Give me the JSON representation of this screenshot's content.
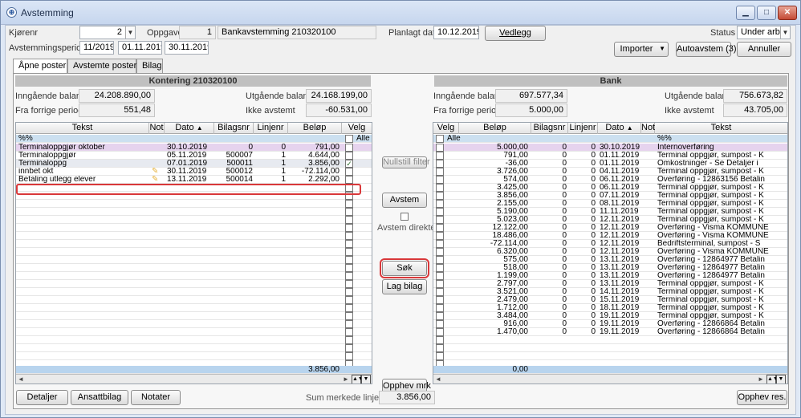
{
  "window": {
    "title": "Avstemming",
    "minimize": "▁",
    "maximize": "□",
    "close": "✕"
  },
  "header": {
    "kjorenr_label": "Kjørenr",
    "kjorenr_value": "2",
    "oppgave_label": "Oppgave",
    "oppgave_value": "1",
    "oppgave_text": "Bankavstemming 210320100",
    "planlagt_label": "Planlagt dato",
    "planlagt_value": "10.12.2019",
    "vedlegg_label": "Vedlegg",
    "status_label": "Status",
    "status_value": "Under arbeid",
    "periode_label": "Avstemmingsperiode",
    "periode_value": "11/2019",
    "fra_dato": "01.11.2019",
    "til_dato": "30.11.2019",
    "importer_label": "Importer",
    "autoavstem_label": "Autoavstem (3)",
    "annuller_label": "Annuller"
  },
  "tabs": [
    "Åpne poster",
    "Avstemte poster",
    "Bilag"
  ],
  "left": {
    "section_title": "Kontering 210320100",
    "inngaende_label": "Inngående balanse",
    "inngaende_value": "24.208.890,00",
    "utgaende_label": "Utgående balanse",
    "utgaende_value": "24.168.199,00",
    "forrige_label": "Fra forrige periode",
    "forrige_value": "551,48",
    "ikke_label": "Ikke avstemt",
    "ikke_value": "-60.531,00",
    "columns": [
      "Tekst",
      "Not",
      "Dato",
      "Bilagsnr",
      "Linjenr",
      "Beløp",
      "Velg"
    ],
    "filter": {
      "tekst": "%%",
      "velg": "Alle"
    },
    "rows": [
      {
        "tekst": "Terminaloppgjør oktober",
        "dato": "30.10.2019",
        "bilag": "0",
        "linje": "0",
        "belop": "791,00",
        "style": "purple",
        "note": false,
        "checked": false
      },
      {
        "tekst": "Terminaloppgjør",
        "dato": "05.11.2019",
        "bilag": "500007",
        "linje": "1",
        "belop": "4.644,00",
        "style": "",
        "note": false,
        "checked": false
      },
      {
        "tekst": "Terminaloppg",
        "dato": "07.01.2019",
        "bilag": "500011",
        "linje": "1",
        "belop": "3.856,00",
        "style": "sel",
        "note": false,
        "checked": true
      },
      {
        "tekst": "innbet okt",
        "dato": "30.11.2019",
        "bilag": "500012",
        "linje": "1",
        "belop": "-72.114,00",
        "style": "",
        "note": true,
        "checked": false
      },
      {
        "tekst": "Betaling utlegg elever",
        "dato": "13.11.2019",
        "bilag": "500014",
        "linje": "1",
        "belop": "2.292,00",
        "style": "",
        "note": true,
        "checked": false
      }
    ],
    "sum": "3.856,00"
  },
  "middle": {
    "nullstill_label": "Nullstill filter",
    "avstem_label": "Avstem",
    "avstem_direkte_label": "Avstem direkte",
    "sok_label": "Søk",
    "lag_bilag_label": "Lag bilag",
    "opphev_mrk_label": "Opphev mrk"
  },
  "right": {
    "section_title": "Bank",
    "inngaende_label": "Inngående balanse",
    "inngaende_value": "697.577,34",
    "utgaende_label": "Utgående balanse",
    "utgaende_value": "756.673,82",
    "forrige_label": "Fra forrige periode",
    "forrige_value": "5.000,00",
    "ikke_label": "Ikke avstemt",
    "ikke_value": "43.705,00",
    "columns": [
      "Velg",
      "Beløp",
      "Bilagsnr",
      "Linjenr",
      "Dato",
      "Not",
      "Tekst"
    ],
    "filter": {
      "velg": "Alle",
      "tekst": "%%"
    },
    "rows": [
      {
        "belop": "5.000,00",
        "bilag": "0",
        "linje": "0",
        "dato": "30.10.2019",
        "tekst": "Internoverføring",
        "style": "purple"
      },
      {
        "belop": "791,00",
        "bilag": "0",
        "linje": "0",
        "dato": "01.11.2019",
        "tekst": "Terminal oppgjør, sumpost - K",
        "style": ""
      },
      {
        "belop": "-36,00",
        "bilag": "0",
        "linje": "0",
        "dato": "01.11.2019",
        "tekst": "Omkostninger - Se Detaljer i",
        "style": ""
      },
      {
        "belop": "3.726,00",
        "bilag": "0",
        "linje": "0",
        "dato": "04.11.2019",
        "tekst": "Terminal oppgjør, sumpost - K",
        "style": ""
      },
      {
        "belop": "574,00",
        "bilag": "0",
        "linje": "0",
        "dato": "06.11.2019",
        "tekst": "Overføring - 12863156 Betalin",
        "style": ""
      },
      {
        "belop": "3.425,00",
        "bilag": "0",
        "linje": "0",
        "dato": "06.11.2019",
        "tekst": "Terminal oppgjør, sumpost - K",
        "style": ""
      },
      {
        "belop": "3.856,00",
        "bilag": "0",
        "linje": "0",
        "dato": "07.11.2019",
        "tekst": "Terminal oppgjør, sumpost - K",
        "style": ""
      },
      {
        "belop": "2.155,00",
        "bilag": "0",
        "linje": "0",
        "dato": "08.11.2019",
        "tekst": "Terminal oppgjør, sumpost - K",
        "style": ""
      },
      {
        "belop": "5.190,00",
        "bilag": "0",
        "linje": "0",
        "dato": "11.11.2019",
        "tekst": "Terminal oppgjør, sumpost - K",
        "style": ""
      },
      {
        "belop": "5.023,00",
        "bilag": "0",
        "linje": "0",
        "dato": "12.11.2019",
        "tekst": "Terminal oppgjør, sumpost - K",
        "style": ""
      },
      {
        "belop": "12.122,00",
        "bilag": "0",
        "linje": "0",
        "dato": "12.11.2019",
        "tekst": "Overføring - Visma KOMMUNE",
        "style": ""
      },
      {
        "belop": "18.486,00",
        "bilag": "0",
        "linje": "0",
        "dato": "12.11.2019",
        "tekst": "Overføring - Visma KOMMUNE",
        "style": ""
      },
      {
        "belop": "-72.114,00",
        "bilag": "0",
        "linje": "0",
        "dato": "12.11.2019",
        "tekst": "Bedriftsterminal, sumpost - S",
        "style": ""
      },
      {
        "belop": "6.320,00",
        "bilag": "0",
        "linje": "0",
        "dato": "12.11.2019",
        "tekst": "Overføring - Visma KOMMUNE",
        "style": ""
      },
      {
        "belop": "575,00",
        "bilag": "0",
        "linje": "0",
        "dato": "13.11.2019",
        "tekst": "Overføring - 12864977 Betalin",
        "style": ""
      },
      {
        "belop": "518,00",
        "bilag": "0",
        "linje": "0",
        "dato": "13.11.2019",
        "tekst": "Overføring - 12864977 Betalin",
        "style": ""
      },
      {
        "belop": "1.199,00",
        "bilag": "0",
        "linje": "0",
        "dato": "13.11.2019",
        "tekst": "Overføring - 12864977 Betalin",
        "style": ""
      },
      {
        "belop": "2.797,00",
        "bilag": "0",
        "linje": "0",
        "dato": "13.11.2019",
        "tekst": "Terminal oppgjør, sumpost - K",
        "style": ""
      },
      {
        "belop": "3.521,00",
        "bilag": "0",
        "linje": "0",
        "dato": "14.11.2019",
        "tekst": "Terminal oppgjør, sumpost - K",
        "style": ""
      },
      {
        "belop": "2.479,00",
        "bilag": "0",
        "linje": "0",
        "dato": "15.11.2019",
        "tekst": "Terminal oppgjør, sumpost - K",
        "style": ""
      },
      {
        "belop": "1.712,00",
        "bilag": "0",
        "linje": "0",
        "dato": "18.11.2019",
        "tekst": "Terminal oppgjør, sumpost - K",
        "style": ""
      },
      {
        "belop": "3.484,00",
        "bilag": "0",
        "linje": "0",
        "dato": "19.11.2019",
        "tekst": "Terminal oppgjør, sumpost - K",
        "style": ""
      },
      {
        "belop": "916,00",
        "bilag": "0",
        "linje": "0",
        "dato": "19.11.2019",
        "tekst": "Overføring - 12866864 Betalin",
        "style": ""
      },
      {
        "belop": "1.470,00",
        "bilag": "0",
        "linje": "0",
        "dato": "19.11.2019",
        "tekst": "Overføring - 12866864 Betalin",
        "style": ""
      }
    ],
    "sum": "0,00"
  },
  "footer": {
    "detaljer_label": "Detaljer",
    "ansattbilag_label": "Ansattbilag",
    "notater_label": "Notater",
    "sum_label": "Sum merkede linjer",
    "sum_value": "3.856,00",
    "opphev_res_label": "Opphev res."
  },
  "colors": {
    "purple_row": "#e6d3ee",
    "filter_row": "#cce0f0",
    "highlight": "#d9383a"
  }
}
